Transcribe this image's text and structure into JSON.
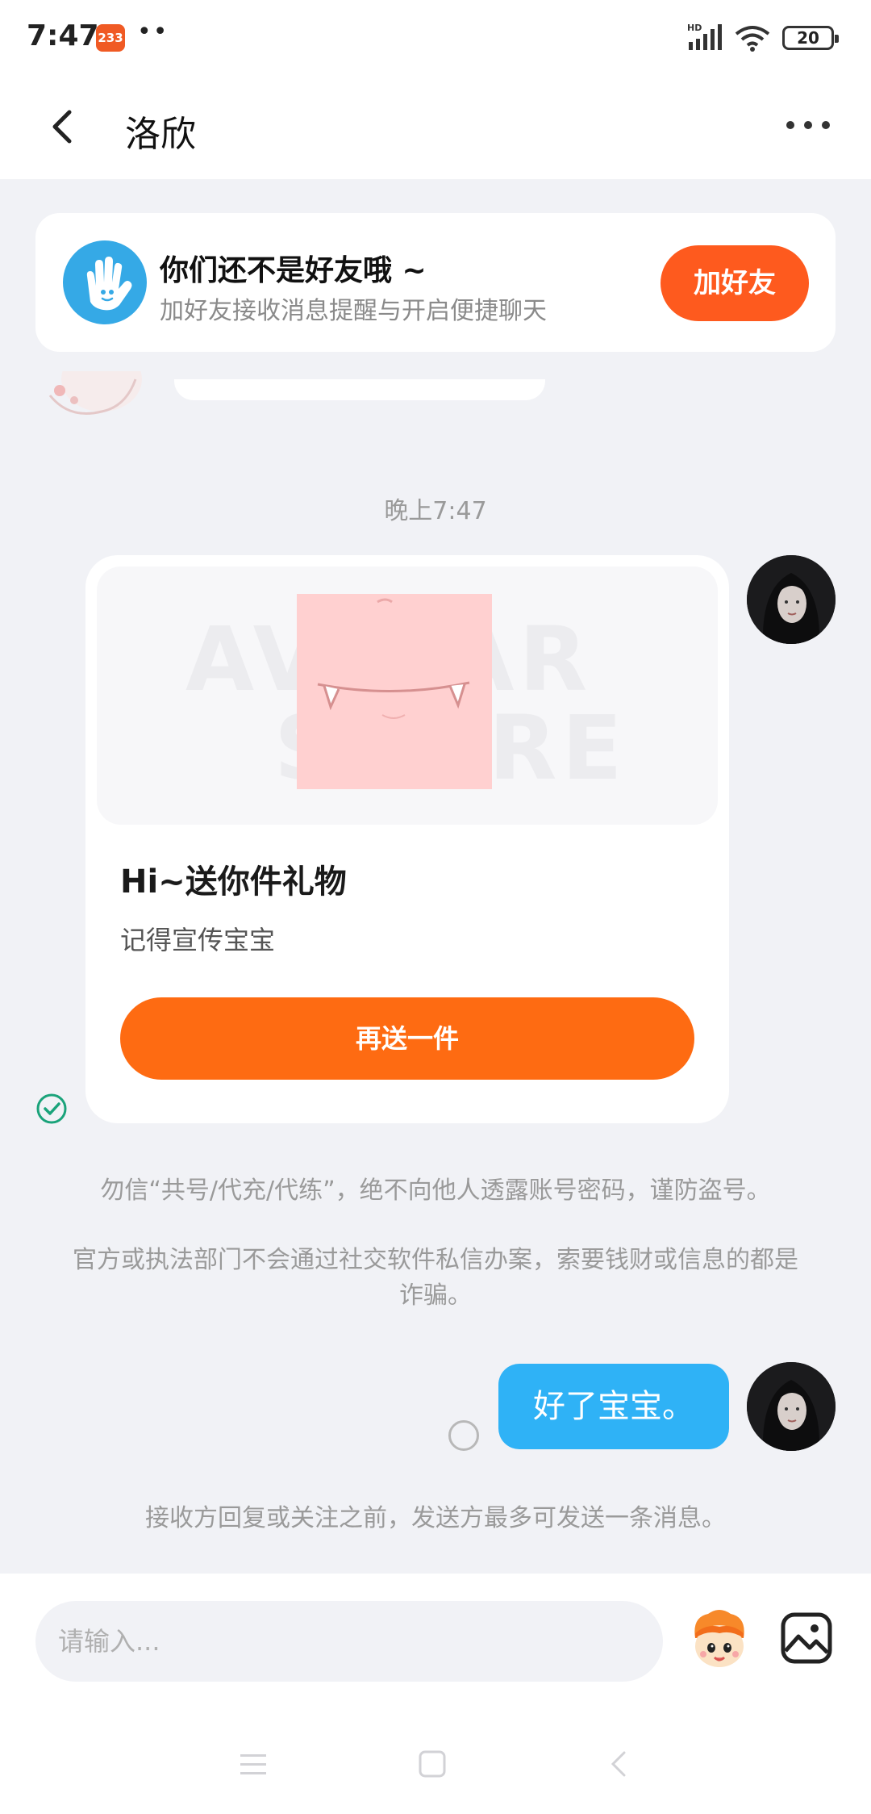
{
  "status_bar": {
    "time": "7:47",
    "app_badge": "233",
    "dots": "••",
    "battery": "20"
  },
  "header": {
    "title": "洛欣"
  },
  "friend_banner": {
    "title": "你们还不是好友哦 ~",
    "subtitle": "加好友接收消息提醒与开启便捷聊天",
    "button_label": "加好友"
  },
  "timestamp": "晚上7:47",
  "gift_card": {
    "watermark_line1": "AVATAR",
    "watermark_line2": "STORE",
    "title": "Hi~送你件礼物",
    "description": "记得宣传宝宝",
    "button_label": "再送一件"
  },
  "notices": {
    "warning1": "勿信“共号/代充/代练”，绝不向他人透露账号密码，谨防盗号。",
    "warning2": "官方或执法部门不会通过社交软件私信办案，索要钱财或信息的都是诈骗。",
    "limit": "接收方回复或关注之前，发送方最多可发送一条消息。"
  },
  "my_message": {
    "text": "好了宝宝。"
  },
  "input": {
    "placeholder": "请输入..."
  },
  "colors": {
    "accent_orange": "#fe5a1e",
    "bubble_blue": "#2fb2f6",
    "background": "#f1f2f6"
  }
}
